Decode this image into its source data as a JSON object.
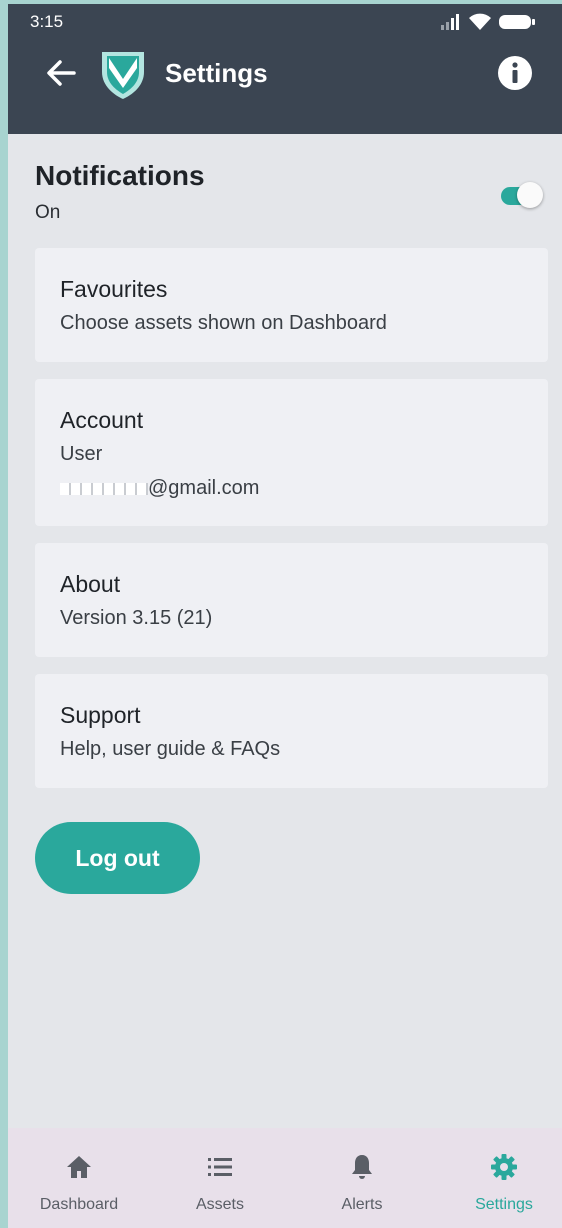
{
  "status_bar": {
    "time": "3:15"
  },
  "app_bar": {
    "title": "Settings"
  },
  "notifications": {
    "title": "Notifications",
    "state_label": "On",
    "enabled": true
  },
  "cards": {
    "favourites": {
      "title": "Favourites",
      "subtitle": "Choose assets shown on Dashboard"
    },
    "account": {
      "title": "Account",
      "line1": "User",
      "email": "@gmail.com"
    },
    "about": {
      "title": "About",
      "subtitle": "Version 3.15 (21)"
    },
    "support": {
      "title": "Support",
      "subtitle": "Help, user guide & FAQs"
    }
  },
  "logout_label": "Log out",
  "bottom_nav": {
    "items": [
      {
        "label": "Dashboard",
        "icon": "home-icon"
      },
      {
        "label": "Assets",
        "icon": "list-icon"
      },
      {
        "label": "Alerts",
        "icon": "bell-icon"
      },
      {
        "label": "Settings",
        "icon": "gear-icon",
        "active": true
      }
    ]
  },
  "colors": {
    "accent": "#2aa89c",
    "app_bar": "#3b4552",
    "background": "#e4e6ea",
    "card": "#eff0f4",
    "nav_bar": "#e8e0ea"
  }
}
